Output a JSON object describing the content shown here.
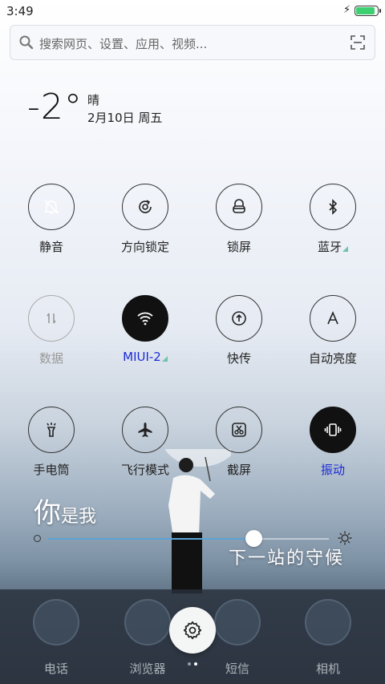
{
  "status_bar": {
    "time": "3:49",
    "battery_color": "#3cd070",
    "battery_level": 0.92
  },
  "search": {
    "placeholder": "搜索网页、设置、应用、视频..."
  },
  "weather": {
    "temperature": "-2°",
    "condition": "晴",
    "date": "2月10日 周五"
  },
  "toggles": [
    {
      "label": "静音",
      "icon": "bell-off-icon",
      "state": "on"
    },
    {
      "label": "方向锁定",
      "icon": "rotation-lock-icon",
      "state": "off"
    },
    {
      "label": "锁屏",
      "icon": "lock-icon",
      "state": "off"
    },
    {
      "label": "蓝牙",
      "icon": "bluetooth-icon",
      "state": "off"
    },
    {
      "label": "数据",
      "icon": "mobile-data-icon",
      "state": "disabled"
    },
    {
      "label": "MIUI-2",
      "icon": "wifi-icon",
      "state": "on"
    },
    {
      "label": "快传",
      "icon": "quick-transfer-icon",
      "state": "off"
    },
    {
      "label": "自动亮度",
      "icon": "auto-brightness-icon",
      "state": "off"
    },
    {
      "label": "手电筒",
      "icon": "flashlight-icon",
      "state": "off"
    },
    {
      "label": "飞行模式",
      "icon": "airplane-icon",
      "state": "off"
    },
    {
      "label": "截屏",
      "icon": "screenshot-icon",
      "state": "off"
    },
    {
      "label": "振动",
      "icon": "vibrate-icon",
      "state": "on"
    }
  ],
  "brightness": {
    "level": 0.73,
    "track_color": "#5aa4d6"
  },
  "wallpaper_text": {
    "line1_big": "你",
    "line1_small": "是我",
    "line2": "下一站的守候"
  },
  "dock": [
    {
      "label": "电话",
      "icon": "phone-icon"
    },
    {
      "label": "浏览器",
      "icon": "browser-icon"
    },
    {
      "label": "短信",
      "icon": "messages-icon"
    },
    {
      "label": "相机",
      "icon": "camera-icon"
    }
  ],
  "page_indicator": {
    "count": 2,
    "active": 1
  },
  "colors": {
    "active_label": "#1a2bd6",
    "active_circle": "#111111",
    "signal_corner": "#6fc3a9"
  }
}
